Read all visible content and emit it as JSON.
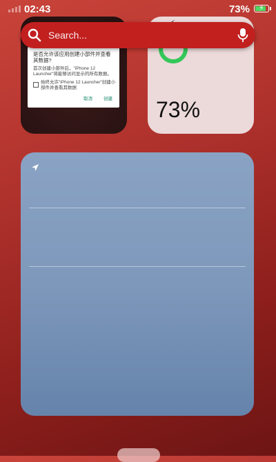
{
  "status_bar": {
    "time": "02:43",
    "battery_percent": "73%",
    "battery_level": 0.73,
    "charging": true
  },
  "search": {
    "placeholder": "Search...",
    "icon": "search-icon",
    "mic_icon": "microphone-icon"
  },
  "app_widget": {
    "dialog_title": "是否允许该应用创建小部件并查看其数据?",
    "dialog_body": "首次创建小部件后，\"iPhone 12 Launcher\"将能够访问显示的所有数据。",
    "dialog_checkbox": "始终允许\"iPhone 12 Launcher\"创建小部件并查看其数据",
    "cancel_label": "取消",
    "create_label": "创建"
  },
  "battery_widget": {
    "percent": "73%",
    "level": 0.73,
    "ring_color": "#34c759"
  },
  "weather_widget": {
    "location_icon": "location-arrow-icon"
  },
  "colors": {
    "search_bar": "#c1201f",
    "weather_top": "#8aa3c4",
    "weather_bottom": "#6583ab"
  }
}
